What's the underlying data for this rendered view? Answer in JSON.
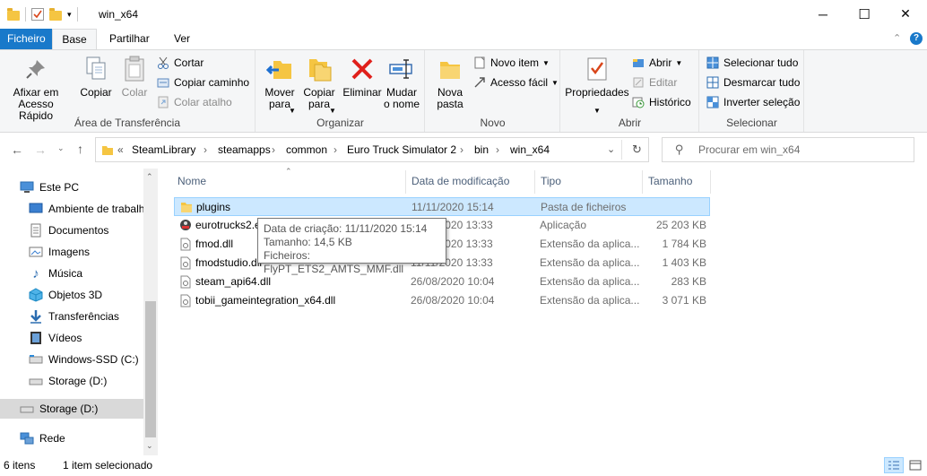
{
  "window": {
    "title": "win_x64",
    "minimize": "─",
    "maximize": "☐",
    "close": "✕"
  },
  "tabs": {
    "file": "Ficheiro",
    "home": "Base",
    "share": "Partilhar",
    "view": "Ver"
  },
  "ribbon": {
    "clipboard": {
      "label": "Área de Transferência",
      "pin": "Afixar em\nAcesso Rápido",
      "copy": "Copiar",
      "paste": "Colar",
      "cut": "Cortar",
      "copy_path": "Copiar caminho",
      "paste_shortcut": "Colar atalho"
    },
    "organize": {
      "label": "Organizar",
      "move_to": "Mover\npara",
      "copy_to": "Copiar\npara",
      "delete": "Eliminar",
      "rename": "Mudar\no nome"
    },
    "new": {
      "label": "Novo",
      "new_folder": "Nova\npasta",
      "new_item": "Novo item",
      "easy_access": "Acesso fácil"
    },
    "open": {
      "label": "Abrir",
      "properties": "Propriedades",
      "open": "Abrir",
      "edit": "Editar",
      "history": "Histórico"
    },
    "select": {
      "label": "Selecionar",
      "select_all": "Selecionar tudo",
      "select_none": "Desmarcar tudo",
      "invert": "Inverter seleção"
    }
  },
  "address": {
    "overflow": "«",
    "crumbs": [
      "SteamLibrary",
      "steamapps",
      "common",
      "Euro Truck Simulator 2",
      "bin",
      "win_x64"
    ],
    "separator": "›",
    "search_placeholder": "Procurar em win_x64"
  },
  "nav": {
    "items": [
      {
        "label": "Este PC",
        "icon": "pc-icon"
      },
      {
        "label": "Ambiente de trabalh",
        "icon": "desktop-icon"
      },
      {
        "label": "Documentos",
        "icon": "documents-icon"
      },
      {
        "label": "Imagens",
        "icon": "pictures-icon"
      },
      {
        "label": "Música",
        "icon": "music-icon"
      },
      {
        "label": "Objetos 3D",
        "icon": "3d-objects-icon"
      },
      {
        "label": "Transferências",
        "icon": "downloads-icon"
      },
      {
        "label": "Vídeos",
        "icon": "videos-icon"
      },
      {
        "label": "Windows-SSD (C:)",
        "icon": "drive-c-icon"
      },
      {
        "label": "Storage (D:)",
        "icon": "drive-d-icon"
      },
      {
        "label": "Storage (D:)",
        "icon": "drive-d-icon"
      },
      {
        "label": "Rede",
        "icon": "network-icon"
      }
    ]
  },
  "columns": {
    "name": "Nome",
    "modified": "Data de modificação",
    "type": "Tipo",
    "size": "Tamanho"
  },
  "files": [
    {
      "name": "plugins",
      "modified": "11/11/2020 15:14",
      "type": "Pasta de ficheiros",
      "size": "",
      "icon": "folder-icon"
    },
    {
      "name": "eurotrucks2.e",
      "modified": "11/11/2020 13:33",
      "type": "Aplicação",
      "size": "25 203 KB",
      "icon": "exe-icon"
    },
    {
      "name": "fmod.dll",
      "modified": "11/11/2020 13:33",
      "type": "Extensão da aplica...",
      "size": "1 784 KB",
      "icon": "dll-icon"
    },
    {
      "name": "fmodstudio.dll",
      "modified": "11/11/2020 13:33",
      "type": "Extensão da aplica...",
      "size": "1 403 KB",
      "icon": "dll-icon"
    },
    {
      "name": "steam_api64.dll",
      "modified": "26/08/2020 10:04",
      "type": "Extensão da aplica...",
      "size": "283 KB",
      "icon": "dll-icon"
    },
    {
      "name": "tobii_gameintegration_x64.dll",
      "modified": "26/08/2020 10:04",
      "type": "Extensão da aplica...",
      "size": "3 071 KB",
      "icon": "dll-icon"
    }
  ],
  "tooltip": {
    "created": "Data de criação: 11/11/2020 15:14",
    "size": "Tamanho: 14,5 KB",
    "files": "Ficheiros: FlyPT_ETS2_AMTS_MMF.dll"
  },
  "status": {
    "items": "6 itens",
    "selected": "1 item selecionado"
  },
  "colors": {
    "accent": "#1979ca",
    "selection": "#cce8ff",
    "selection_border": "#99d1ff"
  }
}
